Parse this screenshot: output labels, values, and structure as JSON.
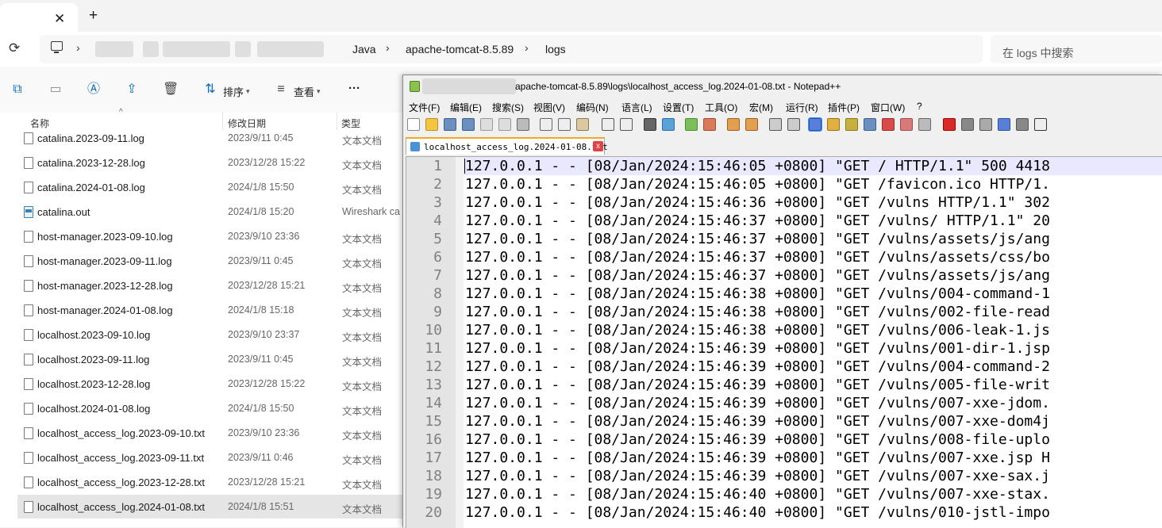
{
  "explorer": {
    "tab_close": "✕",
    "tab_new": "+",
    "breadcrumb": [
      "Java",
      "apache-tomcat-8.5.89",
      "logs"
    ],
    "search_placeholder": "在 logs 中搜索",
    "toolbar": {
      "sort_label": "排序",
      "view_label": "查看",
      "more_label": "···"
    },
    "columns": {
      "name": "名称",
      "modified": "修改日期",
      "type": "类型"
    },
    "files": [
      {
        "name": "catalina.2023-09-11.log",
        "date": "2023/9/11 0:45",
        "type": "文本文档"
      },
      {
        "name": "catalina.2023-12-28.log",
        "date": "2023/12/28 15:22",
        "type": "文本文档"
      },
      {
        "name": "catalina.2024-01-08.log",
        "date": "2024/1/8 15:50",
        "type": "文本文档"
      },
      {
        "name": "catalina.out",
        "date": "2024/1/8 15:20",
        "type": "Wireshark ca"
      },
      {
        "name": "host-manager.2023-09-10.log",
        "date": "2023/9/10 23:36",
        "type": "文本文档"
      },
      {
        "name": "host-manager.2023-09-11.log",
        "date": "2023/9/11 0:45",
        "type": "文本文档"
      },
      {
        "name": "host-manager.2023-12-28.log",
        "date": "2023/12/28 15:21",
        "type": "文本文档"
      },
      {
        "name": "host-manager.2024-01-08.log",
        "date": "2024/1/8 15:18",
        "type": "文本文档"
      },
      {
        "name": "localhost.2023-09-10.log",
        "date": "2023/9/10 23:37",
        "type": "文本文档"
      },
      {
        "name": "localhost.2023-09-11.log",
        "date": "2023/9/11 0:45",
        "type": "文本文档"
      },
      {
        "name": "localhost.2023-12-28.log",
        "date": "2023/12/28 15:22",
        "type": "文本文档"
      },
      {
        "name": "localhost.2024-01-08.log",
        "date": "2024/1/8 15:50",
        "type": "文本文档"
      },
      {
        "name": "localhost_access_log.2023-09-10.txt",
        "date": "2023/9/10 23:36",
        "type": "文本文档"
      },
      {
        "name": "localhost_access_log.2023-09-11.txt",
        "date": "2023/9/11 0:46",
        "type": "文本文档"
      },
      {
        "name": "localhost_access_log.2023-12-28.txt",
        "date": "2023/12/28 15:21",
        "type": "文本文档"
      },
      {
        "name": "localhost_access_log.2024-01-08.txt",
        "date": "2024/1/8 15:51",
        "type": "文本文档"
      }
    ]
  },
  "notepad": {
    "title": "apache-tomcat-8.5.89\\logs\\localhost_access_log.2024-01-08.txt - Notepad++",
    "menu": [
      "文件(F)",
      "编辑(E)",
      "搜索(S)",
      "视图(V)",
      "编码(N)",
      "语言(L)",
      "设置(T)",
      "工具(O)",
      "宏(M)",
      "运行(R)",
      "插件(P)",
      "窗口(W)",
      "?"
    ],
    "tab_name": "localhost_access_log.2024-01-08.txt",
    "tab_close": "x",
    "lines": [
      "127.0.0.1 - - [08/Jan/2024:15:46:05 +0800] \"GET / HTTP/1.1\" 500 4418",
      "127.0.0.1 - - [08/Jan/2024:15:46:05 +0800] \"GET /favicon.ico HTTP/1.",
      "127.0.0.1 - - [08/Jan/2024:15:46:36 +0800] \"GET /vulns HTTP/1.1\" 302",
      "127.0.0.1 - - [08/Jan/2024:15:46:37 +0800] \"GET /vulns/ HTTP/1.1\" 20",
      "127.0.0.1 - - [08/Jan/2024:15:46:37 +0800] \"GET /vulns/assets/js/ang",
      "127.0.0.1 - - [08/Jan/2024:15:46:37 +0800] \"GET /vulns/assets/css/bo",
      "127.0.0.1 - - [08/Jan/2024:15:46:37 +0800] \"GET /vulns/assets/js/ang",
      "127.0.0.1 - - [08/Jan/2024:15:46:38 +0800] \"GET /vulns/004-command-1",
      "127.0.0.1 - - [08/Jan/2024:15:46:38 +0800] \"GET /vulns/002-file-read",
      "127.0.0.1 - - [08/Jan/2024:15:46:38 +0800] \"GET /vulns/006-leak-1.js",
      "127.0.0.1 - - [08/Jan/2024:15:46:39 +0800] \"GET /vulns/001-dir-1.jsp",
      "127.0.0.1 - - [08/Jan/2024:15:46:39 +0800] \"GET /vulns/004-command-2",
      "127.0.0.1 - - [08/Jan/2024:15:46:39 +0800] \"GET /vulns/005-file-writ",
      "127.0.0.1 - - [08/Jan/2024:15:46:39 +0800] \"GET /vulns/007-xxe-jdom.",
      "127.0.0.1 - - [08/Jan/2024:15:46:39 +0800] \"GET /vulns/007-xxe-dom4j",
      "127.0.0.1 - - [08/Jan/2024:15:46:39 +0800] \"GET /vulns/008-file-uplo",
      "127.0.0.1 - - [08/Jan/2024:15:46:39 +0800] \"GET /vulns/007-xxe.jsp H",
      "127.0.0.1 - - [08/Jan/2024:15:46:39 +0800] \"GET /vulns/007-xxe-sax.j",
      "127.0.0.1 - - [08/Jan/2024:15:46:40 +0800] \"GET /vulns/007-xxe-stax.",
      "127.0.0.1 - - [08/Jan/2024:15:46:40 +0800] \"GET /vulns/010-jstl-impo"
    ]
  }
}
